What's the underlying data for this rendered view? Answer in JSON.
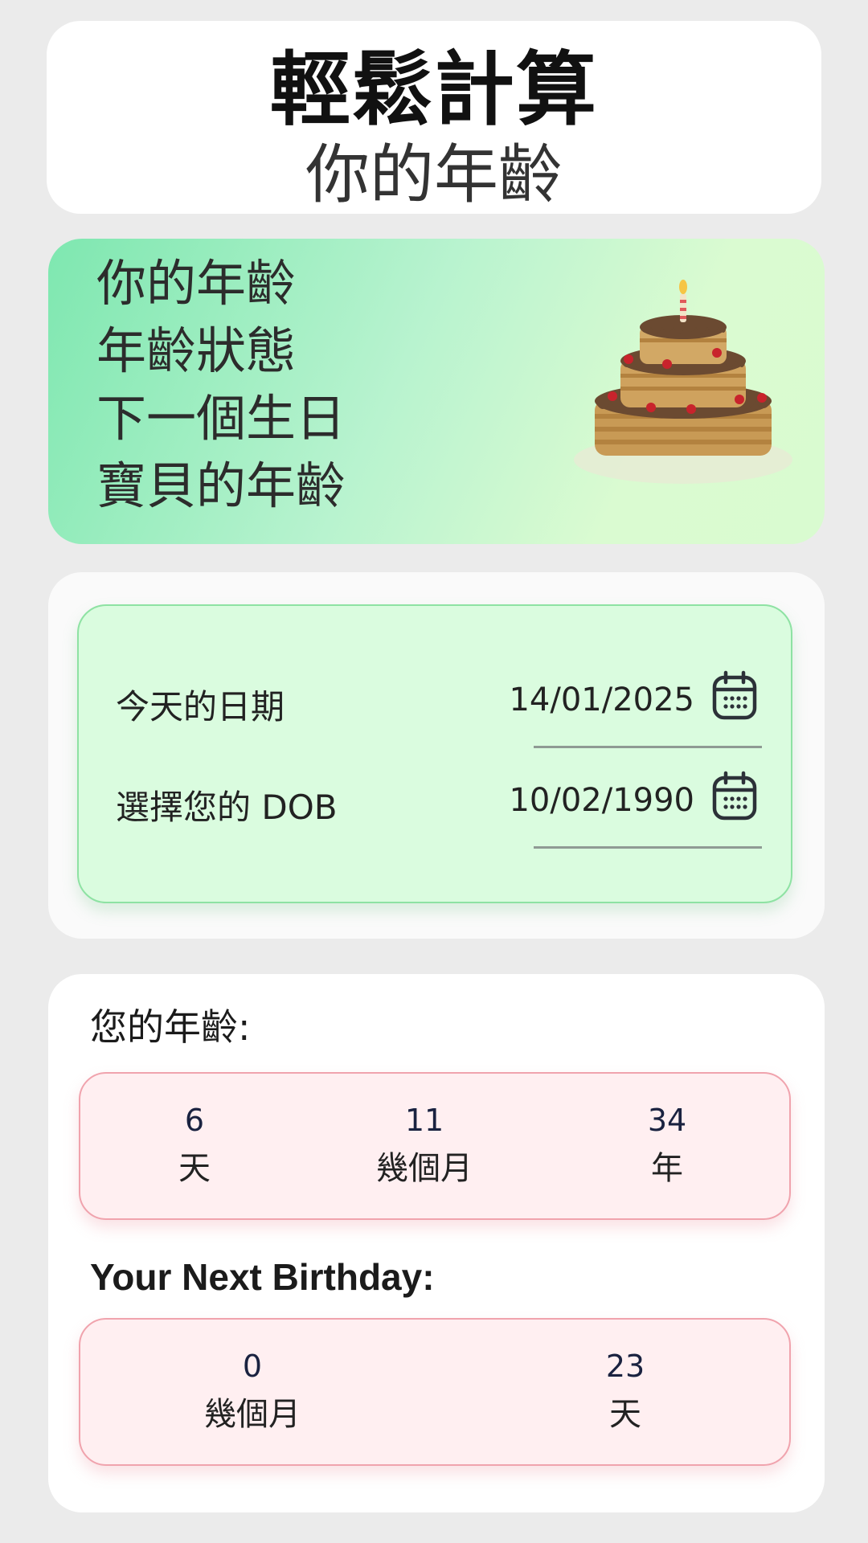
{
  "header": {
    "title": "輕鬆計算",
    "subtitle": "你的年齡"
  },
  "banner": {
    "lines": [
      "你的年齡",
      "年齡狀態",
      "下一個生日",
      "寶貝的年齡"
    ],
    "image": "birthday-cake"
  },
  "dates": {
    "today": {
      "label": "今天的日期",
      "value": "14/01/2025",
      "icon": "calendar-icon"
    },
    "dob": {
      "label": "選擇您的 DOB",
      "value": "10/02/1990",
      "icon": "calendar-icon"
    }
  },
  "age": {
    "title": "您的年齡:",
    "cells": [
      {
        "value": "6",
        "unit": "天"
      },
      {
        "value": "11",
        "unit": "幾個月"
      },
      {
        "value": "34",
        "unit": "年"
      }
    ]
  },
  "next_birthday": {
    "title": "Your Next Birthday:",
    "cells": [
      {
        "value": "0",
        "unit": "幾個月"
      },
      {
        "value": "23",
        "unit": "天"
      }
    ]
  },
  "colors": {
    "background": "#ebebeb",
    "banner_start": "#7ee7b0",
    "banner_end": "#d9fbd0",
    "date_panel": "#dafcdf",
    "result_box": "#ffeff1",
    "result_border": "#f0a3ad"
  }
}
